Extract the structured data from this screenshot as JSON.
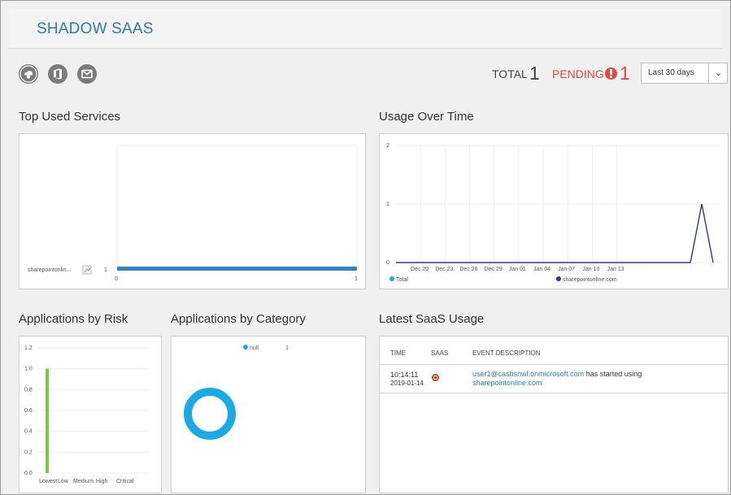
{
  "header": {
    "title": "SHADOW SAAS"
  },
  "toolbar": {
    "icons": [
      "cloud-user-icon",
      "office-icon",
      "mail-icon"
    ],
    "total_label": "TOTAL",
    "total_value": "1",
    "pending_label": "PENDING",
    "pending_value": "1",
    "range": {
      "selected": "Last 30 days"
    }
  },
  "sections": {
    "top_used": "Top Used Services",
    "usage": "Usage Over Time",
    "risk": "Applications by Risk",
    "category": "Applications by Category",
    "latest": "Latest SaaS Usage"
  },
  "colors": {
    "accent": "#2b7bb9",
    "pending": "#e8473f",
    "bar": "#2e86c1",
    "line": "#2a3a8f",
    "risk_bar": "#7ac943",
    "donut": "#19a9e6"
  },
  "top_used_chart": {
    "type": "bar",
    "categories": [
      "sharepointonlin..."
    ],
    "values": [
      1
    ],
    "value_label": "1",
    "xlim": [
      0,
      1
    ],
    "x_ticks": [
      "0",
      "1"
    ]
  },
  "chart_data": [
    {
      "type": "bar",
      "categories": [
        "sharepointonlin..."
      ],
      "values": [
        1
      ],
      "xlim": [
        0,
        1
      ]
    },
    {
      "type": "line",
      "x_ticks": [
        "Dec 20",
        "Dec 23",
        "Dec 26",
        "Dec 29",
        "Jan 01",
        "Jan 04",
        "Jan 07",
        "Jan 10",
        "Jan 13"
      ],
      "y_ticks": [
        "0",
        "1",
        "2"
      ],
      "ylim": [
        0,
        2
      ],
      "series": [
        {
          "name": "Total",
          "values": []
        },
        {
          "name": "sharepointonline.com",
          "values": [
            0,
            0,
            0,
            0,
            0,
            0,
            0,
            0,
            0,
            0,
            0,
            0,
            0,
            0,
            0,
            0,
            0,
            0,
            0,
            0,
            0,
            0,
            0,
            0,
            0,
            0,
            0,
            1,
            0
          ]
        }
      ]
    },
    {
      "type": "bar",
      "categories": [
        "Lowest",
        "Low",
        "Medium",
        "High",
        "Critical"
      ],
      "values": [
        1,
        0,
        0,
        0,
        0
      ],
      "y_ticks": [
        "0.0",
        "0.2",
        "0.4",
        "0.6",
        "0.8",
        "1.0",
        "1.2"
      ],
      "ylim": [
        0,
        1.2
      ]
    },
    {
      "type": "pie",
      "labels": [
        "null"
      ],
      "values": [
        1
      ]
    }
  ],
  "usage_legend": {
    "total": "Total",
    "series": "sharepointonline.com"
  },
  "category_legend": {
    "label": "null",
    "value": "1"
  },
  "latest_table": {
    "columns": [
      "TIME",
      "SAAS",
      "EVENT DESCRIPTION"
    ],
    "rows": [
      {
        "time": "10:14:11",
        "date": "2019-01-14",
        "user": "user1@casbsnwl.onmicrosoft.com",
        "action": " has started using",
        "service": "sharepointonline.com"
      }
    ]
  }
}
